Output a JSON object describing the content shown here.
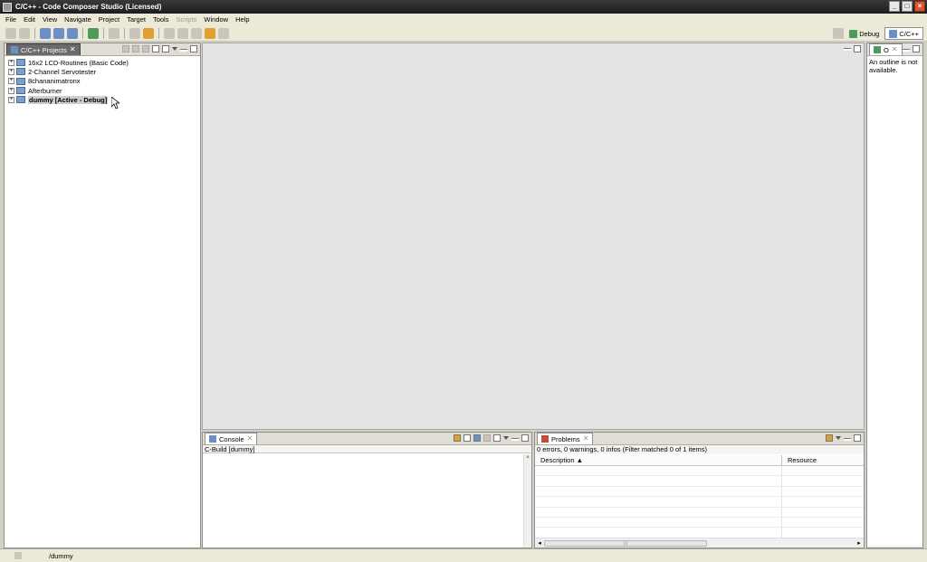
{
  "window": {
    "title": "C/C++ - Code Composer Studio (Licensed)",
    "buttons": [
      "_",
      "□",
      "×"
    ]
  },
  "menu": [
    "File",
    "Edit",
    "View",
    "Navigate",
    "Project",
    "Target",
    "Tools",
    "Scripts",
    "Window",
    "Help"
  ],
  "perspectives": [
    {
      "label": "Debug",
      "icon": "debug-perspective-icon",
      "active": false
    },
    {
      "label": "C/C++",
      "icon": "cpp-perspective-icon",
      "active": true
    }
  ],
  "projects_view": {
    "tab_label": "C/C++ Projects",
    "close_glyph": "✕",
    "items": [
      {
        "expander": "+",
        "label": "16x2 LCD-Routines (Basic Code)"
      },
      {
        "expander": "+",
        "label": "2-Channel Servotester"
      },
      {
        "expander": "+",
        "label": "8chananimatronx"
      },
      {
        "expander": "+",
        "label": "Afterburner"
      },
      {
        "expander": "+",
        "label": "dummy  [Active - Debug]"
      }
    ]
  },
  "outline_view": {
    "tab_label": "O",
    "close_glyph": "✕",
    "message": "An outline is not available."
  },
  "console_view": {
    "tab_label": "Console",
    "close_glyph": "✕",
    "subtitle": "C-Build [dummy]"
  },
  "problems_view": {
    "tab_label": "Problems",
    "close_glyph": "✕",
    "summary": "0 errors, 0 warnings, 0 infos (Filter matched 0 of 1 items)",
    "columns": [
      "Description ▲",
      "Resource"
    ],
    "scroll_left": "◂",
    "scroll_right": "▸",
    "scroll_mid": "|||"
  },
  "status_bar": {
    "text": "/dummy"
  }
}
